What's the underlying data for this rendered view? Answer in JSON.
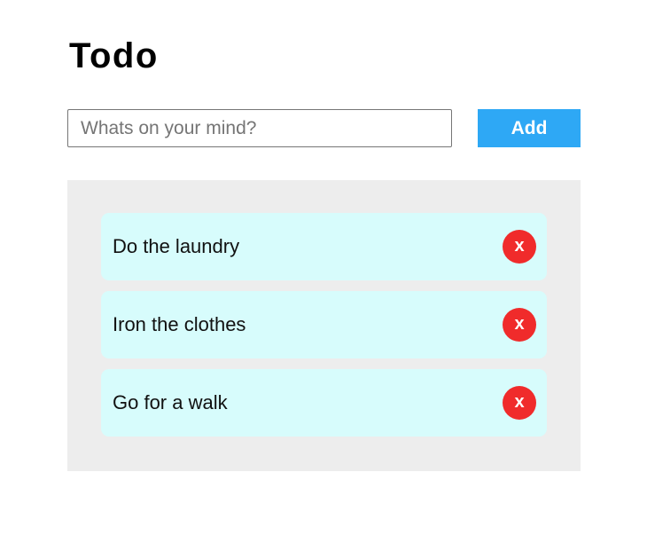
{
  "header": {
    "title": "Todo"
  },
  "form": {
    "input_placeholder": "Whats on your mind?",
    "input_value": "",
    "add_label": "Add"
  },
  "todos": [
    {
      "text": "Do the laundry",
      "delete_label": "x"
    },
    {
      "text": "Iron the clothes",
      "delete_label": "x"
    },
    {
      "text": "Go for a walk",
      "delete_label": "x"
    }
  ],
  "colors": {
    "accent": "#2ea8f5",
    "delete": "#f02b2b",
    "item_background": "#d7fcfc",
    "panel_background": "#ededed"
  }
}
